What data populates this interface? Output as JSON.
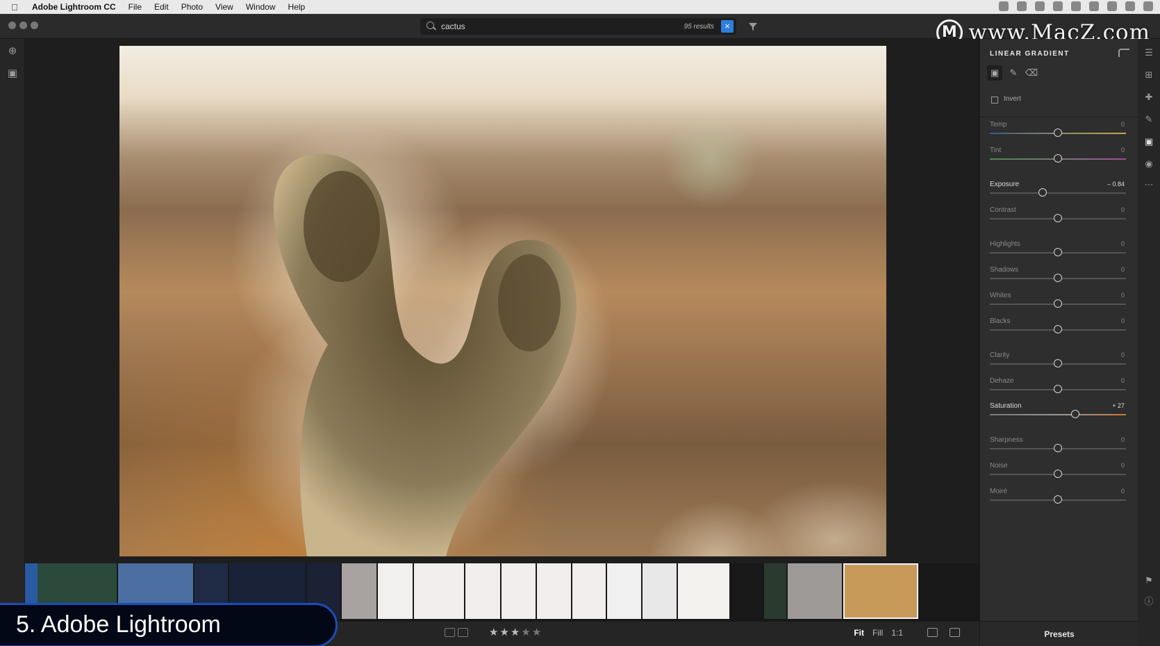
{
  "menubar": {
    "app_name": "Adobe Lightroom CC",
    "items": [
      "File",
      "Edit",
      "Photo",
      "View",
      "Window",
      "Help"
    ]
  },
  "search": {
    "query": "cactus",
    "results": "95 results"
  },
  "watermark": {
    "logo": "M",
    "text": "www.MacZ.com"
  },
  "edit_panel": {
    "title": "LINEAR GRADIENT",
    "invert_label": "Invert",
    "sliders": [
      {
        "label": "Temp",
        "value": "0",
        "position": 0.5,
        "edited": false,
        "track": "temp"
      },
      {
        "label": "Tint",
        "value": "0",
        "position": 0.5,
        "edited": false,
        "track": "tint"
      },
      {
        "label": "Exposure",
        "value": "– 0.84",
        "position": 0.39,
        "edited": true,
        "track": "plain"
      },
      {
        "label": "Contrast",
        "value": "0",
        "position": 0.5,
        "edited": false,
        "track": "plain"
      },
      {
        "label": "Highlights",
        "value": "0",
        "position": 0.5,
        "edited": false,
        "track": "plain"
      },
      {
        "label": "Shadows",
        "value": "0",
        "position": 0.5,
        "edited": false,
        "track": "plain"
      },
      {
        "label": "Whites",
        "value": "0",
        "position": 0.5,
        "edited": false,
        "track": "plain"
      },
      {
        "label": "Blacks",
        "value": "0",
        "position": 0.5,
        "edited": false,
        "track": "plain"
      },
      {
        "label": "Clarity",
        "value": "0",
        "position": 0.5,
        "edited": false,
        "track": "plain"
      },
      {
        "label": "Dehaze",
        "value": "0",
        "position": 0.5,
        "edited": false,
        "track": "plain"
      },
      {
        "label": "Saturation",
        "value": "+ 27",
        "position": 0.63,
        "edited": true,
        "track": "sat"
      },
      {
        "label": "Sharpness",
        "value": "0",
        "position": 0.5,
        "edited": false,
        "track": "plain"
      },
      {
        "label": "Noise",
        "value": "0",
        "position": 0.5,
        "edited": false,
        "track": "plain"
      },
      {
        "label": "Moiré",
        "value": "0",
        "position": 0.5,
        "edited": false,
        "track": "plain"
      }
    ],
    "presets_label": "Presets"
  },
  "bottom_bar": {
    "stars_filled": 3,
    "stars_total": 5,
    "zoom_options": [
      "Fit",
      "Fill",
      "1:1"
    ],
    "zoom_active": "Fit"
  },
  "caption": {
    "text": "5. Adobe Lightroom"
  },
  "colors": {
    "accent": "#2f7de1",
    "caption_border": "#1b4db8"
  },
  "filmstrip": [
    {
      "tone": "#2a5aa0"
    },
    {
      "tone": "#2b4a3c"
    },
    {
      "tone": "#4a6ea0"
    },
    {
      "tone": "#1f2a45"
    },
    {
      "tone": "#1a2238"
    },
    {
      "tone": "#1b2236"
    },
    {
      "tone": "#a8a2a0"
    },
    {
      "tone": "#f2f0ee"
    },
    {
      "tone": "#f2eeee"
    },
    {
      "tone": "#f2eeee"
    },
    {
      "tone": "#f2eeee"
    },
    {
      "tone": "#f2eeee"
    },
    {
      "tone": "#f2eeee"
    },
    {
      "tone": "#f0f0f0"
    },
    {
      "tone": "#e8e8e8"
    },
    {
      "tone": "#f4f2ee"
    },
    {
      "tone": "#2a3a2e"
    },
    {
      "tone": "#9e9a98"
    },
    {
      "tone": "#c79a5a",
      "selected": true
    }
  ]
}
